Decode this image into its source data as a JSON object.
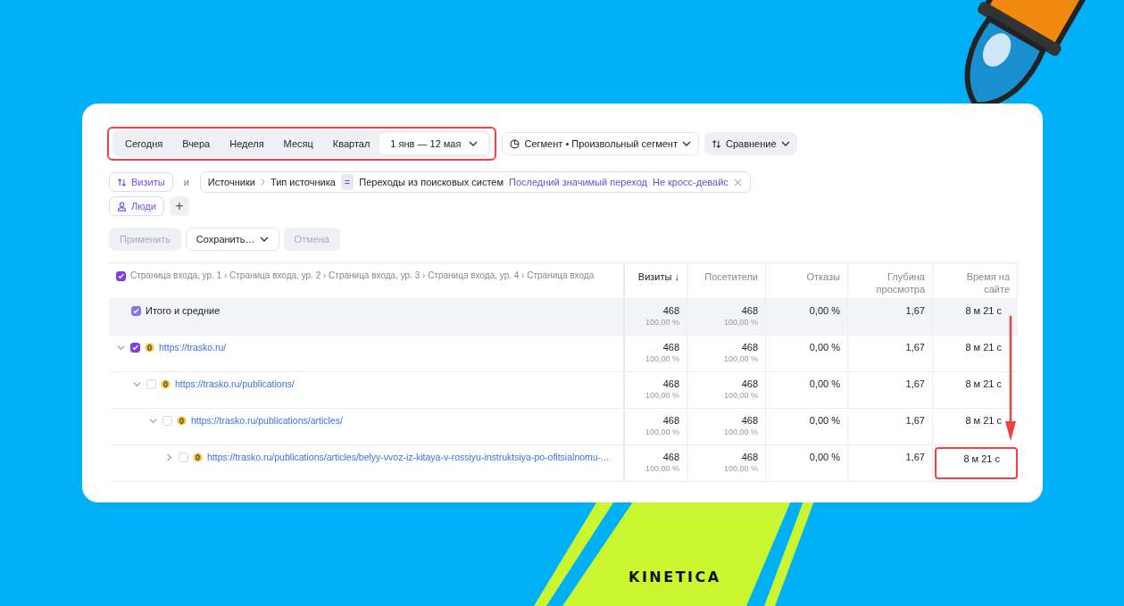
{
  "periods": {
    "highlighted": true,
    "items": [
      {
        "label": "Сегодня",
        "selected": false,
        "kind": "preset"
      },
      {
        "label": "Вчера",
        "selected": false,
        "kind": "preset"
      },
      {
        "label": "Неделя",
        "selected": false,
        "kind": "preset"
      },
      {
        "label": "Месяц",
        "selected": false,
        "kind": "preset"
      },
      {
        "label": "Квартал",
        "selected": false,
        "kind": "preset"
      },
      {
        "label": "1 янв — 12 мая",
        "selected": true,
        "kind": "range"
      }
    ]
  },
  "segment_button": "Сегмент • Произвольный сегмент",
  "compare_button": "Сравнение",
  "filters": {
    "visits_chip": "Визиты",
    "conjunction": "и",
    "condition": {
      "parts": [
        "Источники",
        "Тип источника"
      ],
      "operator": "=",
      "value": "Переходы из поисковых систем",
      "attribution": "Последний значимый переход",
      "device": "Не кросс-девайс"
    },
    "people_chip": "Люди",
    "add_button": "+"
  },
  "actions": [
    {
      "label": "Применить",
      "disabled": true,
      "kind": "button"
    },
    {
      "label": "Сохранить…",
      "disabled": false,
      "kind": "dropdown"
    },
    {
      "label": "Отмена",
      "disabled": true,
      "kind": "button"
    }
  ],
  "table": {
    "dimension_header": {
      "label": "Страница входа, ур. 1 › Страница входа, ур. 2 › Страница входа, ур. 3 › Страница входа, ур. 4 › Страница входа",
      "checked": true
    },
    "columns": [
      {
        "label": "Визиты ↓",
        "sorted": true
      },
      {
        "label": "Посетители",
        "sorted": false
      },
      {
        "label": "Отказы",
        "sorted": false
      },
      {
        "label": "Глубина просмотра",
        "sorted": false
      },
      {
        "label": "Время на сайте",
        "sorted": false
      }
    ],
    "totals": {
      "label": "Итого и средние",
      "checked": true,
      "visits": "468",
      "visits_share": "100,00 %",
      "visitors": "468",
      "visitors_share": "100,00 %",
      "bounce": "0,00 %",
      "depth": "1,67",
      "time": "8 м 21 с"
    },
    "tree": [
      {
        "url": "https://trasko.ru/",
        "checked": true,
        "expanded": true,
        "highlighted": false,
        "visits": "468",
        "visits_share": "100,00 %",
        "visitors": "468",
        "visitors_share": "100,00 %",
        "bounce": "0,00 %",
        "depth": "1,67",
        "time": "8 м 21 с",
        "children": [
          {
            "url": "https://trasko.ru/publications/",
            "checked": false,
            "expanded": true,
            "highlighted": false,
            "visits": "468",
            "visits_share": "100,00 %",
            "visitors": "468",
            "visitors_share": "100,00 %",
            "bounce": "0,00 %",
            "depth": "1,67",
            "time": "8 м 21 с",
            "children": [
              {
                "url": "https://trasko.ru/publications/articles/",
                "checked": false,
                "expanded": true,
                "highlighted": false,
                "visits": "468",
                "visits_share": "100,00 %",
                "visitors": "468",
                "visitors_share": "100,00 %",
                "bounce": "0,00 %",
                "depth": "1,67",
                "time": "8 м 21 с",
                "children": [
                  {
                    "url": "https://trasko.ru/publications/articles/belyy-vvoz-iz-kitaya-v-rossiyu-instruktsiya-po-ofitsialnomu-...",
                    "checked": false,
                    "expanded": false,
                    "highlighted": true,
                    "visits": "468",
                    "visits_share": "100,00 %",
                    "visitors": "468",
                    "visitors_share": "100,00 %",
                    "bounce": "0,00 %",
                    "depth": "1,67",
                    "time": "8 м 21 с"
                  }
                ]
              }
            ]
          }
        ]
      }
    ]
  },
  "brand": "KINETICA"
}
